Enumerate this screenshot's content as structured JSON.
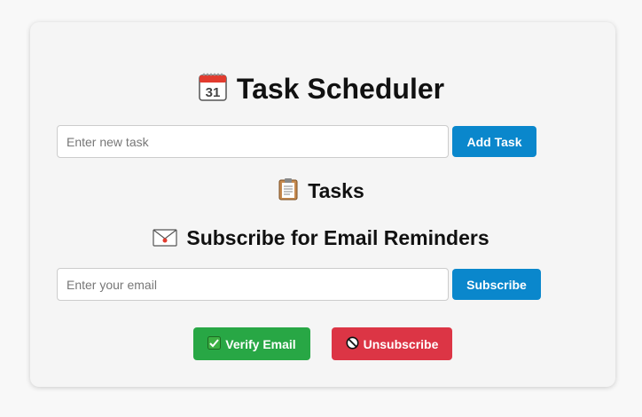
{
  "app": {
    "title": "Task Scheduler"
  },
  "task_form": {
    "input_placeholder": "Enter new task",
    "input_value": "",
    "add_button_label": "Add Task"
  },
  "tasks_section": {
    "heading": "Tasks",
    "items": []
  },
  "subscribe_section": {
    "heading": "Subscribe for Email Reminders",
    "email_placeholder": "Enter your email",
    "email_value": "",
    "subscribe_button_label": "Subscribe"
  },
  "actions": {
    "verify_label": "Verify Email",
    "unsubscribe_label": "Unsubscribe"
  },
  "icons": {
    "title_icon": "calendar-icon",
    "tasks_icon": "clipboard-icon",
    "subscribe_icon": "envelope-icon",
    "verify_icon": "check-mark-icon",
    "unsubscribe_icon": "prohibited-icon"
  },
  "colors": {
    "primary": "#0a87cc",
    "success": "#28a745",
    "danger": "#dc3545",
    "card_background": "#f5f5f5",
    "page_background": "#f8f8f8"
  }
}
